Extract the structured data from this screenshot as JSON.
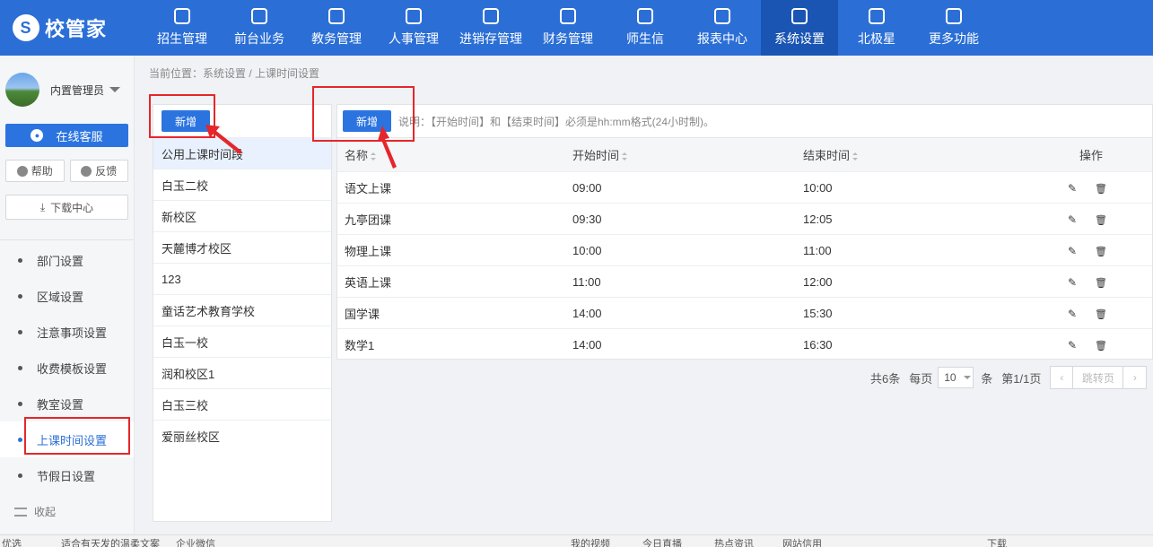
{
  "brand": {
    "name": "校管家"
  },
  "nav": [
    {
      "label": "招生管理",
      "icon": "user-plus-icon"
    },
    {
      "label": "前台业务",
      "icon": "monitor-icon"
    },
    {
      "label": "教务管理",
      "icon": "book-icon"
    },
    {
      "label": "人事管理",
      "icon": "person-icon"
    },
    {
      "label": "进销存管理",
      "icon": "inventory-icon"
    },
    {
      "label": "财务管理",
      "icon": "finance-icon"
    },
    {
      "label": "师生信",
      "icon": "message-icon"
    },
    {
      "label": "报表中心",
      "icon": "report-icon"
    },
    {
      "label": "系统设置",
      "icon": "settings-icon",
      "active": true
    },
    {
      "label": "北极星",
      "icon": "star-icon"
    },
    {
      "label": "更多功能",
      "icon": "more-icon"
    }
  ],
  "user": {
    "name": "内置管理员"
  },
  "sidebar": {
    "service_label": "在线客服",
    "help_label": "帮助",
    "feedback_label": "反馈",
    "download_label": "下载中心",
    "collapse_label": "收起",
    "items": [
      {
        "label": "部门设置"
      },
      {
        "label": "区域设置"
      },
      {
        "label": "注意事项设置"
      },
      {
        "label": "收费模板设置"
      },
      {
        "label": "教室设置"
      },
      {
        "label": "上课时间设置",
        "active": true
      },
      {
        "label": "节假日设置"
      }
    ]
  },
  "breadcrumb": "当前位置：系统设置 / 上课时间设置",
  "campus_panel": {
    "add_label": "新增",
    "items": [
      "公用上课时间段",
      "白玉二校",
      "新校区",
      "天麓博才校区",
      "123",
      "童话艺术教育学校",
      "白玉一校",
      "润和校区1",
      "白玉三校",
      "爱丽丝校区"
    ]
  },
  "main": {
    "add_label": "新增",
    "note": "说明：【开始时间】和【结束时间】必须是hh:mm格式(24小时制)。",
    "columns": {
      "name": "名称",
      "start": "开始时间",
      "end": "结束时间",
      "ops": "操作"
    },
    "rows": [
      {
        "name": "语文上课",
        "start": "09:00",
        "end": "10:00"
      },
      {
        "name": "九亭团课",
        "start": "09:30",
        "end": "12:05"
      },
      {
        "name": "物理上课",
        "start": "10:00",
        "end": "11:00"
      },
      {
        "name": "英语上课",
        "start": "11:00",
        "end": "12:00"
      },
      {
        "name": "国学课",
        "start": "14:00",
        "end": "15:30"
      },
      {
        "name": "数学1",
        "start": "14:00",
        "end": "16:30"
      }
    ]
  },
  "pagination": {
    "total": "共6条",
    "per_page_label": "每页",
    "per_page_value": "10",
    "unit": "条",
    "page_info": "第1/1页",
    "jump_label": "跳转页"
  },
  "bottombar": [
    "优选",
    "适合有天发的温柔文案",
    "企业微信",
    "我的视频",
    "今日直播",
    "热点资讯",
    "网站信用",
    "下载"
  ],
  "colors": {
    "primary": "#2b6fd6",
    "annotation": "#e5262a"
  }
}
